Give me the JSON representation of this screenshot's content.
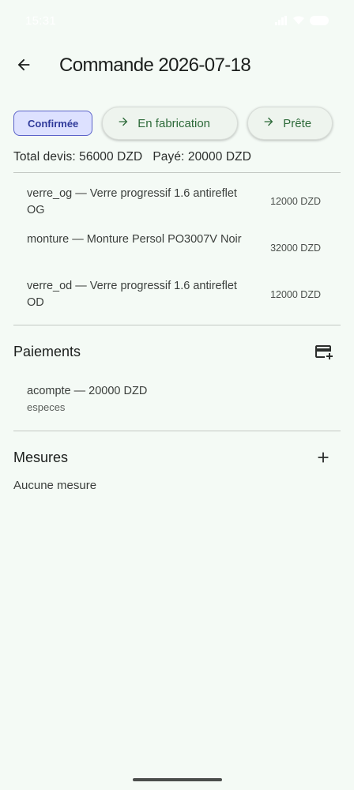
{
  "status_bar": {
    "time": "15:31"
  },
  "header": {
    "title": "Commande 2026-07-18"
  },
  "status_chips": {
    "current": "Confirmée",
    "actions": [
      {
        "label": "En fabrication"
      },
      {
        "label": "Prête"
      }
    ]
  },
  "totals": {
    "quote": "Total devis: 56000 DZD",
    "paid": "Payé: 20000 DZD"
  },
  "items": [
    {
      "description": "verre_og — Verre progressif 1.6 antireflet OG",
      "price": "12000 DZD"
    },
    {
      "description": "monture — Monture Persol PO3007V Noir",
      "price": "32000 DZD"
    },
    {
      "description": "verre_od — Verre progressif 1.6 antireflet OD",
      "price": "12000 DZD"
    }
  ],
  "payments": {
    "title": "Paiements",
    "add_icon": "add-card-icon",
    "entries": [
      {
        "label": "acompte — 20000 DZD",
        "method": "especes"
      }
    ]
  },
  "measures": {
    "title": "Mesures",
    "add_icon": "plus-icon",
    "empty_text": "Aucune mesure"
  },
  "colors": {
    "background": "#f4faf5",
    "chip_selected_bg": "#dde1ff",
    "chip_selected_text": "#2f3a9a",
    "action_text": "#2d6a39"
  }
}
